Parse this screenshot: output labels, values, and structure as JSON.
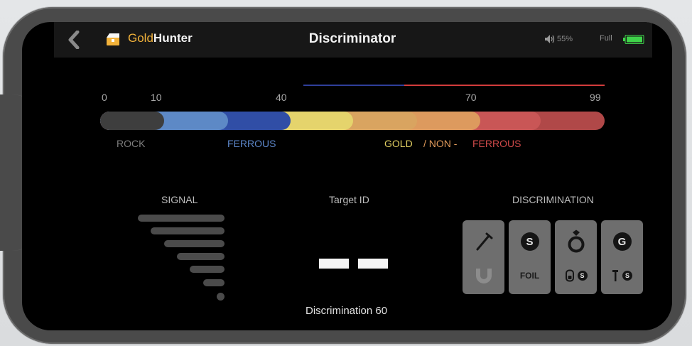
{
  "header": {
    "brand_gold": "Gold",
    "brand_hunter": "Hunter",
    "title": "Discriminator",
    "volume": "55%",
    "battery_label": "Full"
  },
  "scale": {
    "ticks": [
      "0",
      "10",
      "40",
      "70",
      "99"
    ],
    "categories": {
      "rock": "ROCK",
      "ferrous": "FERROUS",
      "gold": "GOLD",
      "sep": "/ NON -",
      "nonferrous": "FERROUS"
    }
  },
  "signal": {
    "label": "SIGNAL"
  },
  "target": {
    "label": "Target ID",
    "discrimination_text": "Discrimination 60"
  },
  "discrimination": {
    "label": "DISCRIMINATION",
    "tiles": [
      {
        "top_icon": "nail-icon",
        "bottom_icon": "magnet-icon"
      },
      {
        "top_icon": "coin-s-icon",
        "top_text": "S",
        "bottom_text": "FOIL"
      },
      {
        "top_icon": "ring-icon",
        "bottom_icon": "pull-tab-icon",
        "bottom_text": "S"
      },
      {
        "top_icon": "coin-g-icon",
        "top_text": "G",
        "bottom_icon": "screw-icon",
        "bottom_text": "S"
      }
    ]
  },
  "colors": {
    "rock": "#3d3d3d",
    "ferrous_light": "#5a86c4",
    "ferrous_dark": "#2f4ea8",
    "gold": "#e6d66e",
    "nonferrous_orange": "#d89a58",
    "nonferrous_red": "#c4484a",
    "range_blue": "#2f3f9a",
    "range_red": "#d23c3c"
  }
}
